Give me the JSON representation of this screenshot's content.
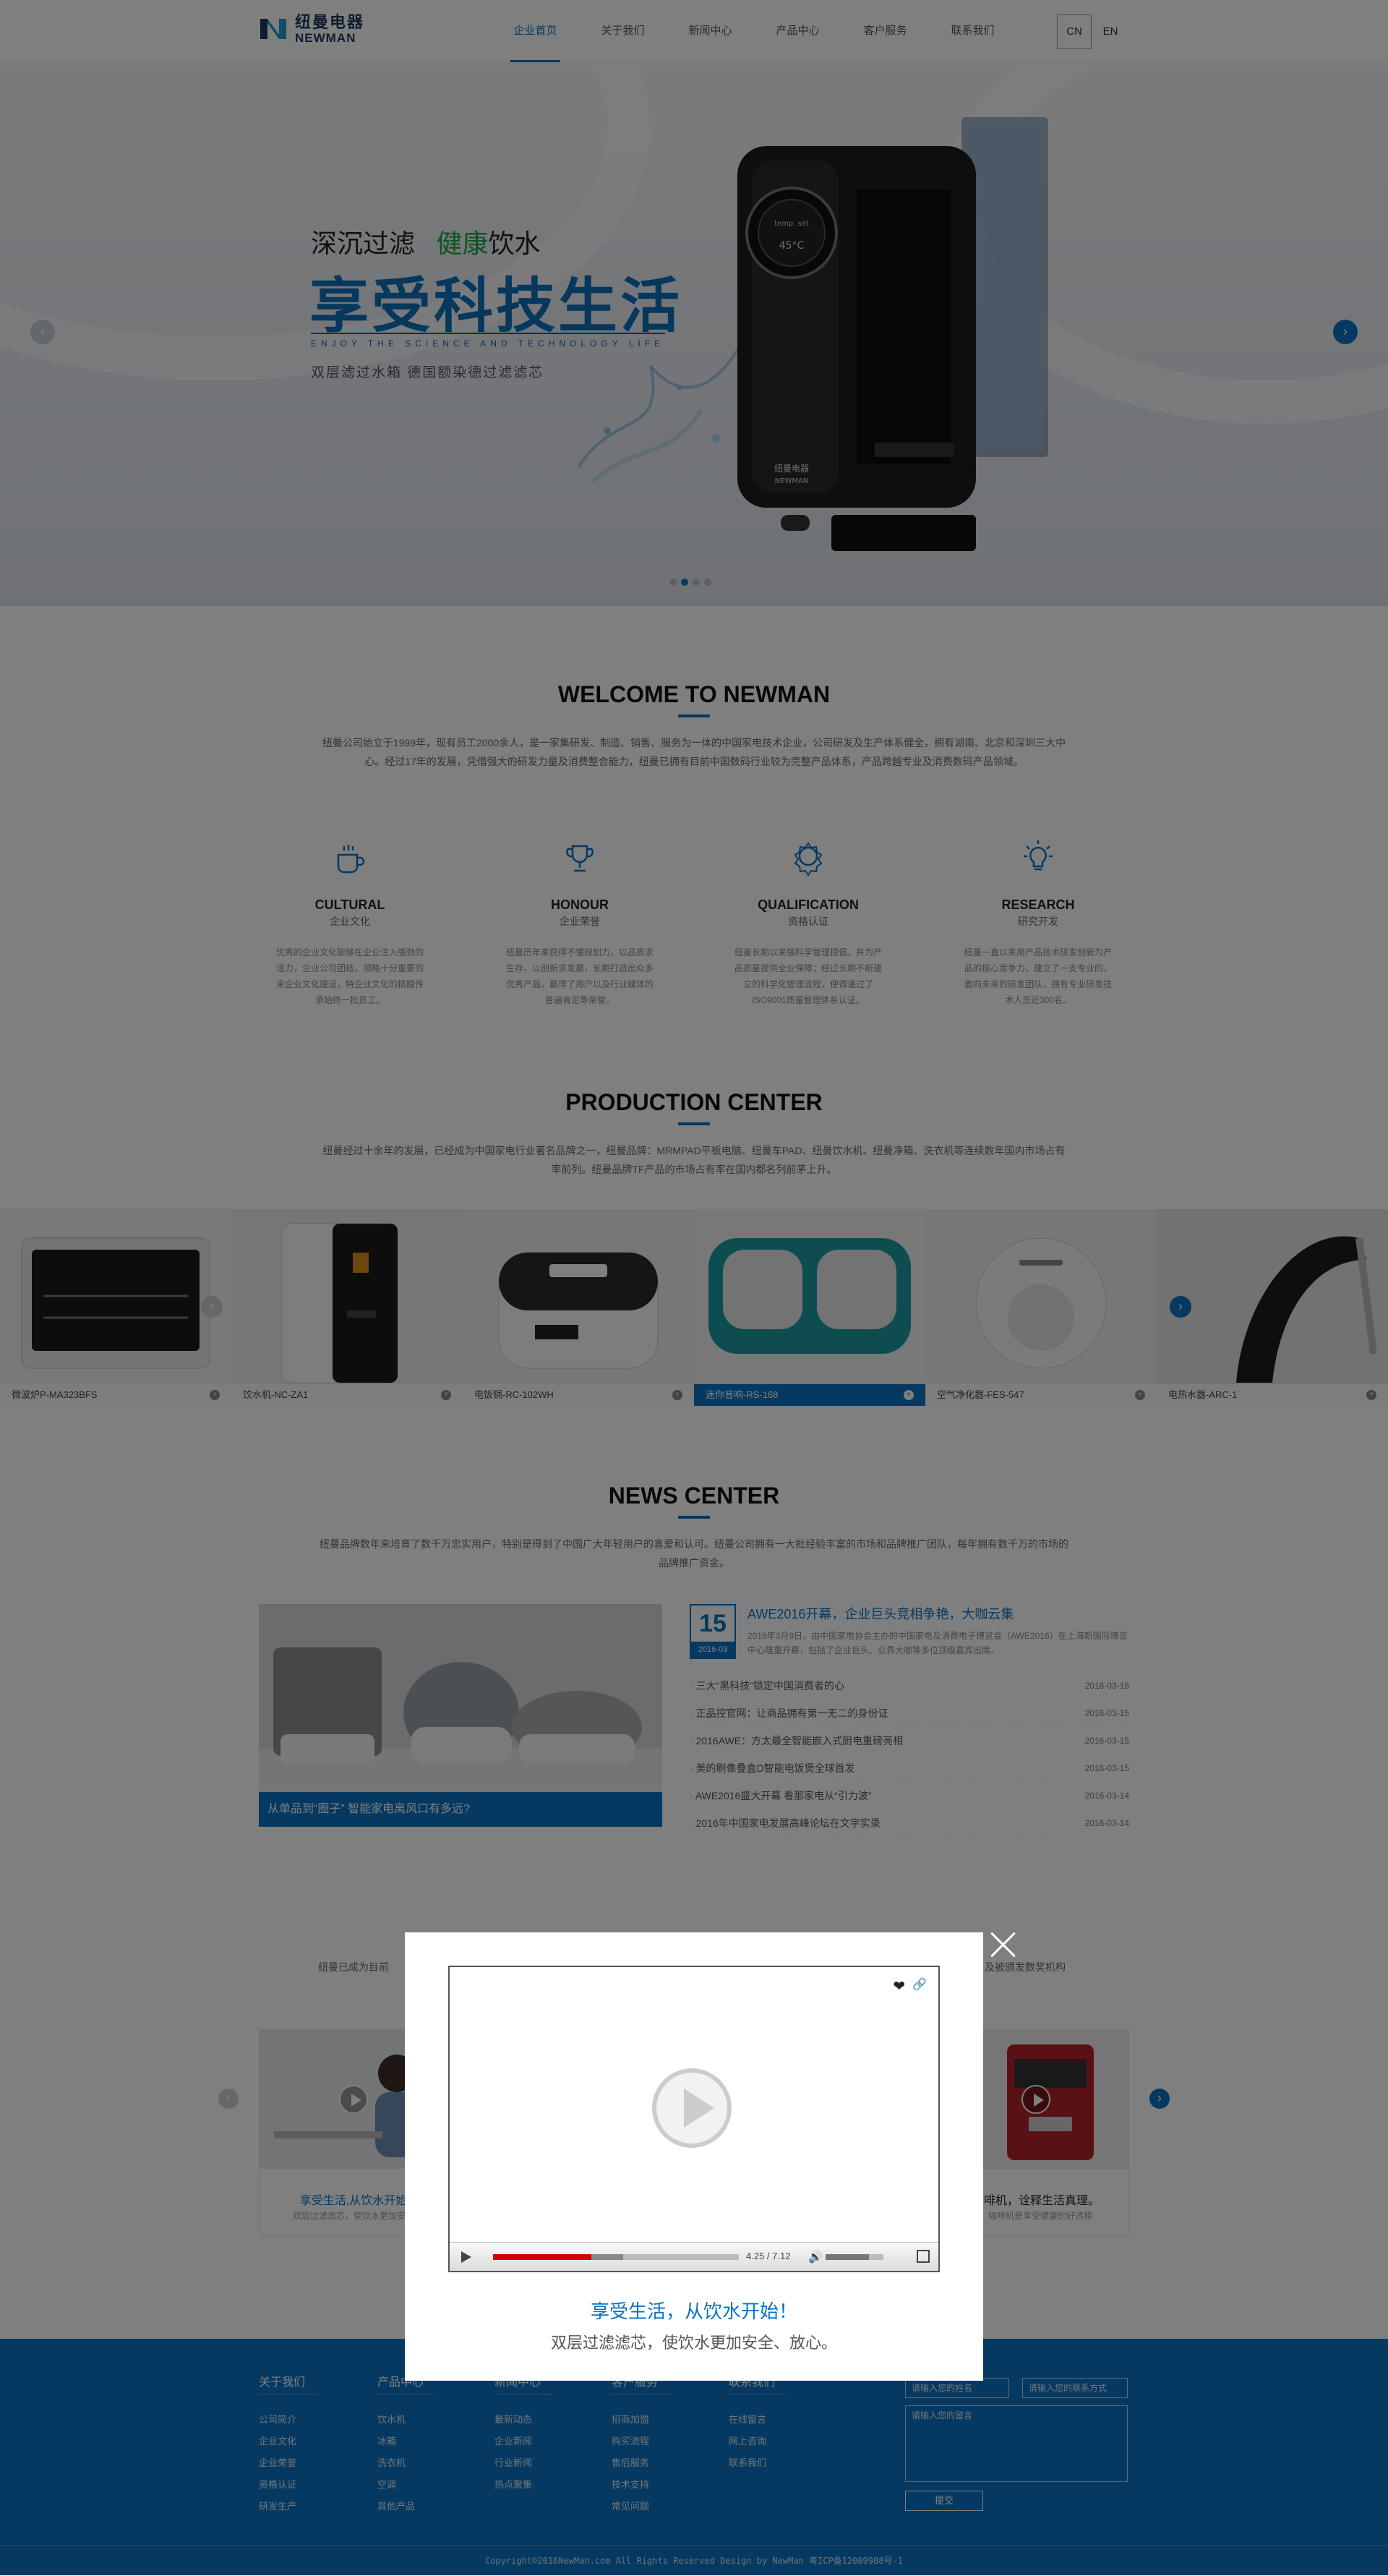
{
  "header": {
    "logo_cn": "纽曼电器",
    "logo_en": "NEWMAN",
    "nav": [
      "企业首页",
      "关于我们",
      "新闻中心",
      "产品中心",
      "客户服务",
      "联系我们"
    ],
    "lang_cn": "CN",
    "lang_en": "EN"
  },
  "banner": {
    "line1_a": "深沉过滤",
    "line1_b": "健康",
    "line1_c": "饮水",
    "line2": "享受科技生活",
    "line3": "ENJOY THE SCIENCE AND TECHNOLOGY LIFE",
    "line4": "双层滤过水箱   德国额染德过滤滤芯",
    "device_brand_cn": "纽曼电器",
    "device_brand_en": "NEWMAN",
    "device_temp": "temp. set",
    "device_display": "45°C",
    "prev": "‹",
    "next": "›",
    "slide_count": 4,
    "active_slide": 2
  },
  "welcome": {
    "title": "WELCOME TO NEWMAN",
    "desc": "纽曼公司始立于1999年，现有员工2000余人，是一家集研发、制造、销售、服务为一体的中国家电技术企业，公司研发及生产体系健全，拥有湖南、北京和深圳三大中心。经过17年的发展，凭借强大的研发力量及消费整合能力，纽曼已拥有目前中国数码行业较为完整产品体系，产品跨越专业及消费数码产品领域。"
  },
  "features": [
    {
      "en": "CULTURAL",
      "cn": "企业文化",
      "desc": "优秀的企业文化能够在企业注入强劲的活力，企业公司团结，领略十分重要的来企业文化建设，特企业文化的精髓传承始终一批员工。",
      "icon": "coffee-cup-icon"
    },
    {
      "en": "HONOUR",
      "cn": "企业荣誉",
      "desc": "纽曼历年来获得不懂规划力，以品质求生存，以创新求发展，长期打造出众多优秀产品，赢得了用户以及行业媒体的普遍肯定等荣誉。",
      "icon": "trophy-icon"
    },
    {
      "en": "QUALIFICATION",
      "cn": "资格认证",
      "desc": "纽曼长期以来强科学管理提倡，并为产品质量提供全业保障；经过长期不断建立的科学化管理流程，使得通过了ISO9001质量管理体系认证。",
      "icon": "badge-icon"
    },
    {
      "en": "RESEARCH",
      "cn": "研究开发",
      "desc": "纽曼一直以来用产品技术研发创新为产品的核心竞争力，建立了一支专业的，面向未来的研发团队，拥有专业研发技术人员近300名。",
      "icon": "lightbulb-icon"
    }
  ],
  "production": {
    "title": "PRODUCTION CENTER",
    "desc": "纽曼经过十余年的发展，已经成为中国家电行业著名品牌之一，纽曼品牌：MRMPAD平板电脑、纽曼车PAD、纽曼饮水机、纽曼净箱、洗衣机等连续数年国内市场占有率前列。纽曼品牌TF产品的市场占有率在国内都名列前茅上升。",
    "products": [
      {
        "name": "微波炉P-MA323BFS"
      },
      {
        "name": "饮水机-NC-ZA1"
      },
      {
        "name": "电饭锅-RC-102WH"
      },
      {
        "name": "迷你音响-RS-168"
      },
      {
        "name": "空气净化器-FES-547"
      },
      {
        "name": "电热水器-ARC-1"
      }
    ],
    "active_index": 3,
    "prev": "‹",
    "next": "›"
  },
  "news": {
    "title": "NEWS CENTER",
    "desc": "纽曼品牌数年来培育了数千万忠实用户，特别是得到了中国广大年轻用户的喜爱和认可。纽曼公司拥有一大批经验丰富的市场和品牌推广团队，每年拥有数千万的市场的品牌推广资金。",
    "feature_caption": "从单品到“圈子” 智能家电离风口有多远?",
    "top_day": "15",
    "top_ym": "2016-03",
    "top_title": "AWE2016开幕，企业巨头竞相争艳，大咖云集",
    "top_summary": "2016年3月9日，由中国家电协会主办的中国家电及消费电子博览会（AWE2016）在上海新国际博览中心隆重开幕，包括了企业巨头、业界大咖等多位顶级嘉宾出席。",
    "items": [
      {
        "title": "三大“黑科技”锁定中国消费者的心",
        "date": "2016-03-15"
      },
      {
        "title": "正品控官网：让商品拥有第一无二的身份证",
        "date": "2016-03-15"
      },
      {
        "title": "2016AWE：方太最全智能嵌入式厨电重磅亮相",
        "date": "2016-03-15"
      },
      {
        "title": "美的刷像叠盒D智能电饭煲全球首发",
        "date": "2016-03-15"
      },
      {
        "title": "AWE2016盛大开幕 看那家电从“引力波”",
        "date": "2016-03-14"
      },
      {
        "title": "2016年中国家电发展高峰论坛在文字实录",
        "date": "2016-03-14"
      }
    ]
  },
  "videos": {
    "desc_left": "纽曼已成为目前",
    "desc_right": "及被颁发数奖机构",
    "card_left_title": "享受生活,从饮水开始",
    "card_left_sub": "双层过滤滤芯，使饮水更加安全",
    "card_right_title": "咖啡机，诠释生活真理。",
    "card_right_sub": "，咖啡机是享受健康的好选择"
  },
  "footer": {
    "cols": [
      {
        "h": "关于我们",
        "items": [
          "公司简介",
          "企业文化",
          "企业荣誉",
          "资格认证",
          "研发生产"
        ]
      },
      {
        "h": "产品中心",
        "items": [
          "饮水机",
          "冰箱",
          "洗衣机",
          "空调",
          "其他产品"
        ]
      },
      {
        "h": "新闻中心",
        "items": [
          "最新动态",
          "企业新闻",
          "行业新闻",
          "热点聚集"
        ]
      },
      {
        "h": "客户服务",
        "items": [
          "招商加盟",
          "购买流程",
          "售后服务",
          "技术支持",
          "常见问题"
        ]
      },
      {
        "h": "联系我们",
        "items": [
          "在线留言",
          "网上咨询",
          "联系我们"
        ]
      }
    ],
    "name_placeholder": "请输入您的姓名",
    "phone_placeholder": "请输入您的联系方式",
    "msg_placeholder": "请输入您的留言",
    "submit": "提交",
    "copyright": "Copyright©2016NewMan.com All Rights Reserved    Design by NewMan 粤ICP备12009988号-1"
  },
  "modal": {
    "time": "4.25 / 7.12",
    "progress": 0.4,
    "buffered": 0.53,
    "volume": 0.75,
    "title": "享受生活，从饮水开始！",
    "subtitle": "双层过滤滤芯，使饮水更加安全、放心。",
    "heart": "❤",
    "link": "🔗",
    "volume_icon": "🔊"
  }
}
